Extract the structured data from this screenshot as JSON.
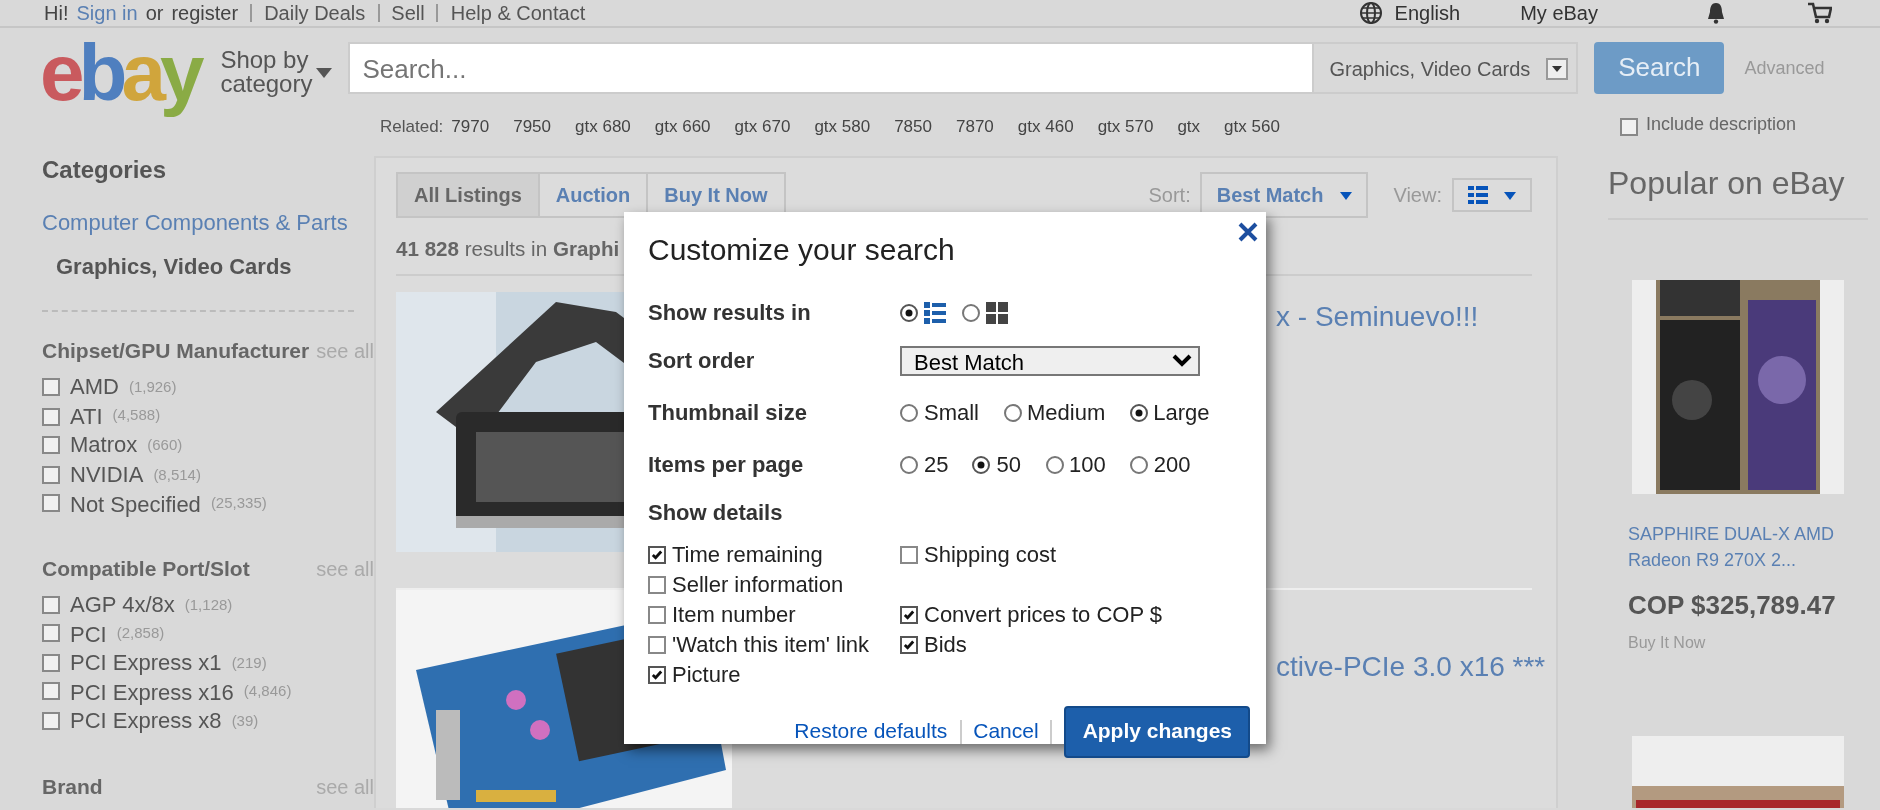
{
  "top_bar": {
    "greeting": "Hi!",
    "sign_in": "Sign in",
    "or": "or",
    "register": "register",
    "links": [
      "Daily Deals",
      "Sell",
      "Help & Contact"
    ],
    "language": "English",
    "my_ebay": "My eBay"
  },
  "header": {
    "logo": [
      {
        "letter": "e",
        "color": "#c95a5e"
      },
      {
        "letter": "b",
        "color": "#4f7fbf"
      },
      {
        "letter": "a",
        "color": "#d0a53c"
      },
      {
        "letter": "y",
        "color": "#8aab45"
      }
    ],
    "shop_by_category": "Shop by category",
    "search_placeholder": "Search...",
    "category": "Graphics, Video Cards",
    "search_button": "Search",
    "advanced": "Advanced",
    "include_description": {
      "label": "Include description",
      "checked": false
    },
    "related_label": "Related:",
    "related": [
      "7970",
      "7950",
      "gtx 680",
      "gtx 660",
      "gtx 670",
      "gtx 580",
      "7850",
      "7870",
      "gtx 460",
      "gtx 570",
      "gtx",
      "gtx 560"
    ]
  },
  "sidebar": {
    "title": "Categories",
    "parent": "Computer Components & Parts",
    "current": "Graphics, Video Cards",
    "filters": [
      {
        "title": "Chipset/GPU Manufacturer",
        "see_all": "see all",
        "options": [
          {
            "label": "AMD",
            "count": "(1,926)",
            "checked": false
          },
          {
            "label": "ATI",
            "count": "(4,588)",
            "checked": false
          },
          {
            "label": "Matrox",
            "count": "(660)",
            "checked": false
          },
          {
            "label": "NVIDIA",
            "count": "(8,514)",
            "checked": false
          },
          {
            "label": "Not Specified",
            "count": "(25,335)",
            "checked": false
          }
        ]
      },
      {
        "title": "Compatible Port/Slot",
        "see_all": "see all",
        "options": [
          {
            "label": "AGP 4x/8x",
            "count": "(1,128)",
            "checked": false
          },
          {
            "label": "PCI",
            "count": "(2,858)",
            "checked": false
          },
          {
            "label": "PCI Express x1",
            "count": "(219)",
            "checked": false
          },
          {
            "label": "PCI Express x16",
            "count": "(4,846)",
            "checked": false
          },
          {
            "label": "PCI Express x8",
            "count": "(39)",
            "checked": false
          }
        ]
      },
      {
        "title": "Brand",
        "see_all": "see all"
      }
    ]
  },
  "results": {
    "tabs": [
      {
        "label": "All Listings",
        "selected": true
      },
      {
        "label": "Auction",
        "selected": false
      },
      {
        "label": "Buy It Now",
        "selected": false
      }
    ],
    "sort_label": "Sort:",
    "sort": "Best Match",
    "view_label": "View:",
    "summary": "**41 828** results in **Graphi**",
    "listings": [
      {
        "title": "x - Seminuevo!!!"
      },
      {
        "title": "ctive-PCIe 3.0 x16 ***"
      }
    ]
  },
  "popular": {
    "title": "Popular on eBay",
    "items": [
      {
        "kind": "product",
        "title": "SAPPHIRE DUAL-X AMD Radeon R9 270X 2...",
        "price": "COP $325,789.47",
        "format": "Buy It Now"
      },
      {
        "kind": "picture"
      }
    ]
  },
  "dialog": {
    "title": "Customize your search",
    "show_results": {
      "label": "Show results in",
      "options": [
        {
          "kind": "list",
          "selected": true
        },
        {
          "kind": "grid",
          "selected": false
        }
      ]
    },
    "sort_order": {
      "label": "Sort order",
      "value": "Best Match"
    },
    "thumbnail_size": {
      "label": "Thumbnail size",
      "options": [
        {
          "label": "Small",
          "selected": false
        },
        {
          "label": "Medium",
          "selected": false
        },
        {
          "label": "Large",
          "selected": true
        }
      ]
    },
    "items_per_page": {
      "label": "Items per page",
      "options": [
        {
          "label": "25",
          "selected": false
        },
        {
          "label": "50",
          "selected": true
        },
        {
          "label": "100",
          "selected": false
        },
        {
          "label": "200",
          "selected": false
        }
      ]
    },
    "show_details": {
      "label": "Show details",
      "left": [
        {
          "label": "Time remaining",
          "checked": true
        },
        {
          "label": "Seller information",
          "checked": false
        },
        {
          "label": "Item number",
          "checked": false
        },
        {
          "label": "'Watch this item' link",
          "checked": false
        },
        {
          "label": "Picture",
          "checked": true
        }
      ],
      "right": [
        {
          "label": "Shipping cost",
          "checked": false
        },
        {
          "label": "Convert prices to COP $",
          "checked": true
        },
        {
          "label": "Bids",
          "checked": true
        }
      ]
    },
    "restore": "Restore defaults",
    "cancel": "Cancel",
    "apply": "Apply changes"
  }
}
